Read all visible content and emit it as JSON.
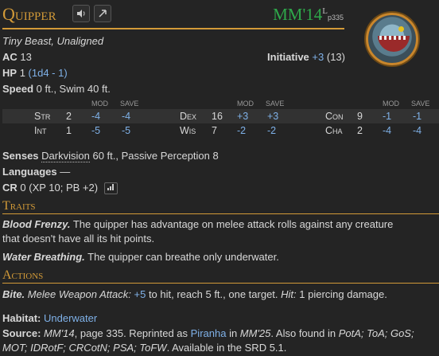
{
  "header": {
    "title": "Quipper",
    "source_abbr": "MM'14",
    "source_flag": "L",
    "source_page": "p335",
    "sound_icon": "speaker-icon",
    "roll_icon": "arrow-icon"
  },
  "meta": {
    "size_type": "Tiny Beast, Unaligned"
  },
  "ac": {
    "label": "AC",
    "value": "13"
  },
  "initiative": {
    "label": "Initiative",
    "mod": "+3",
    "score": "(13)"
  },
  "hp": {
    "label": "HP",
    "value": "1",
    "formula": "(1d4 - 1)"
  },
  "speed": {
    "label": "Speed",
    "value": "0 ft., Swim 40 ft."
  },
  "abilities": {
    "mod_label": "MOD",
    "save_label": "SAVE",
    "groups": [
      [
        {
          "name": "Str",
          "score": "2",
          "mod": "-4",
          "save": "-4"
        },
        {
          "name": "Int",
          "score": "1",
          "mod": "-5",
          "save": "-5"
        }
      ],
      [
        {
          "name": "Dex",
          "score": "16",
          "mod": "+3",
          "save": "+3"
        },
        {
          "name": "Wis",
          "score": "7",
          "mod": "-2",
          "save": "-2"
        }
      ],
      [
        {
          "name": "Con",
          "score": "9",
          "mod": "-1",
          "save": "-1"
        },
        {
          "name": "Cha",
          "score": "2",
          "mod": "-4",
          "save": "-4"
        }
      ]
    ]
  },
  "senses": {
    "label": "Senses",
    "darkvision": "Darkvision",
    "rest": "60 ft., Passive Perception 8"
  },
  "languages": {
    "label": "Languages",
    "value": "—"
  },
  "cr": {
    "label": "CR",
    "value": "0 (XP 10; PB +2)",
    "button_icon": "bar-chart-icon"
  },
  "traits": {
    "heading": "Traits",
    "items": [
      {
        "name": "Blood Frenzy.",
        "text_line1": " The quipper has advantage on melee attack rolls against any creature",
        "text_line2": "that doesn't have all its hit points."
      },
      {
        "name": "Water Breathing.",
        "text": " The quipper can breathe only underwater."
      }
    ]
  },
  "actions": {
    "heading": "Actions",
    "items": [
      {
        "name": "Bite.",
        "attack_type": "Melee Weapon Attack:",
        "to_hit": "+5",
        "mid": " to hit, reach 5 ft., one target. ",
        "hit_label": "Hit:",
        "damage": " 1 piercing damage."
      }
    ]
  },
  "habitat": {
    "label": "Habitat:",
    "value": "Underwater"
  },
  "source_line": {
    "label": "Source:",
    "book": "MM'14",
    "page_text": ", page 335. Reprinted as ",
    "reprint_name": "Piranha",
    "in_text": " in ",
    "reprint_book": "MM'25",
    "also": ". Also found in ",
    "books1": "PotA; ToA; GoS;",
    "books2": "MOT; IDRotF; CRCotN; PSA; ToFW",
    "tail": ". Available in the SRD 5.1."
  },
  "colors": {
    "accent": "#d29a38",
    "link": "#7fb1e8",
    "source_green": "#2ea84a",
    "background": "#242424"
  }
}
